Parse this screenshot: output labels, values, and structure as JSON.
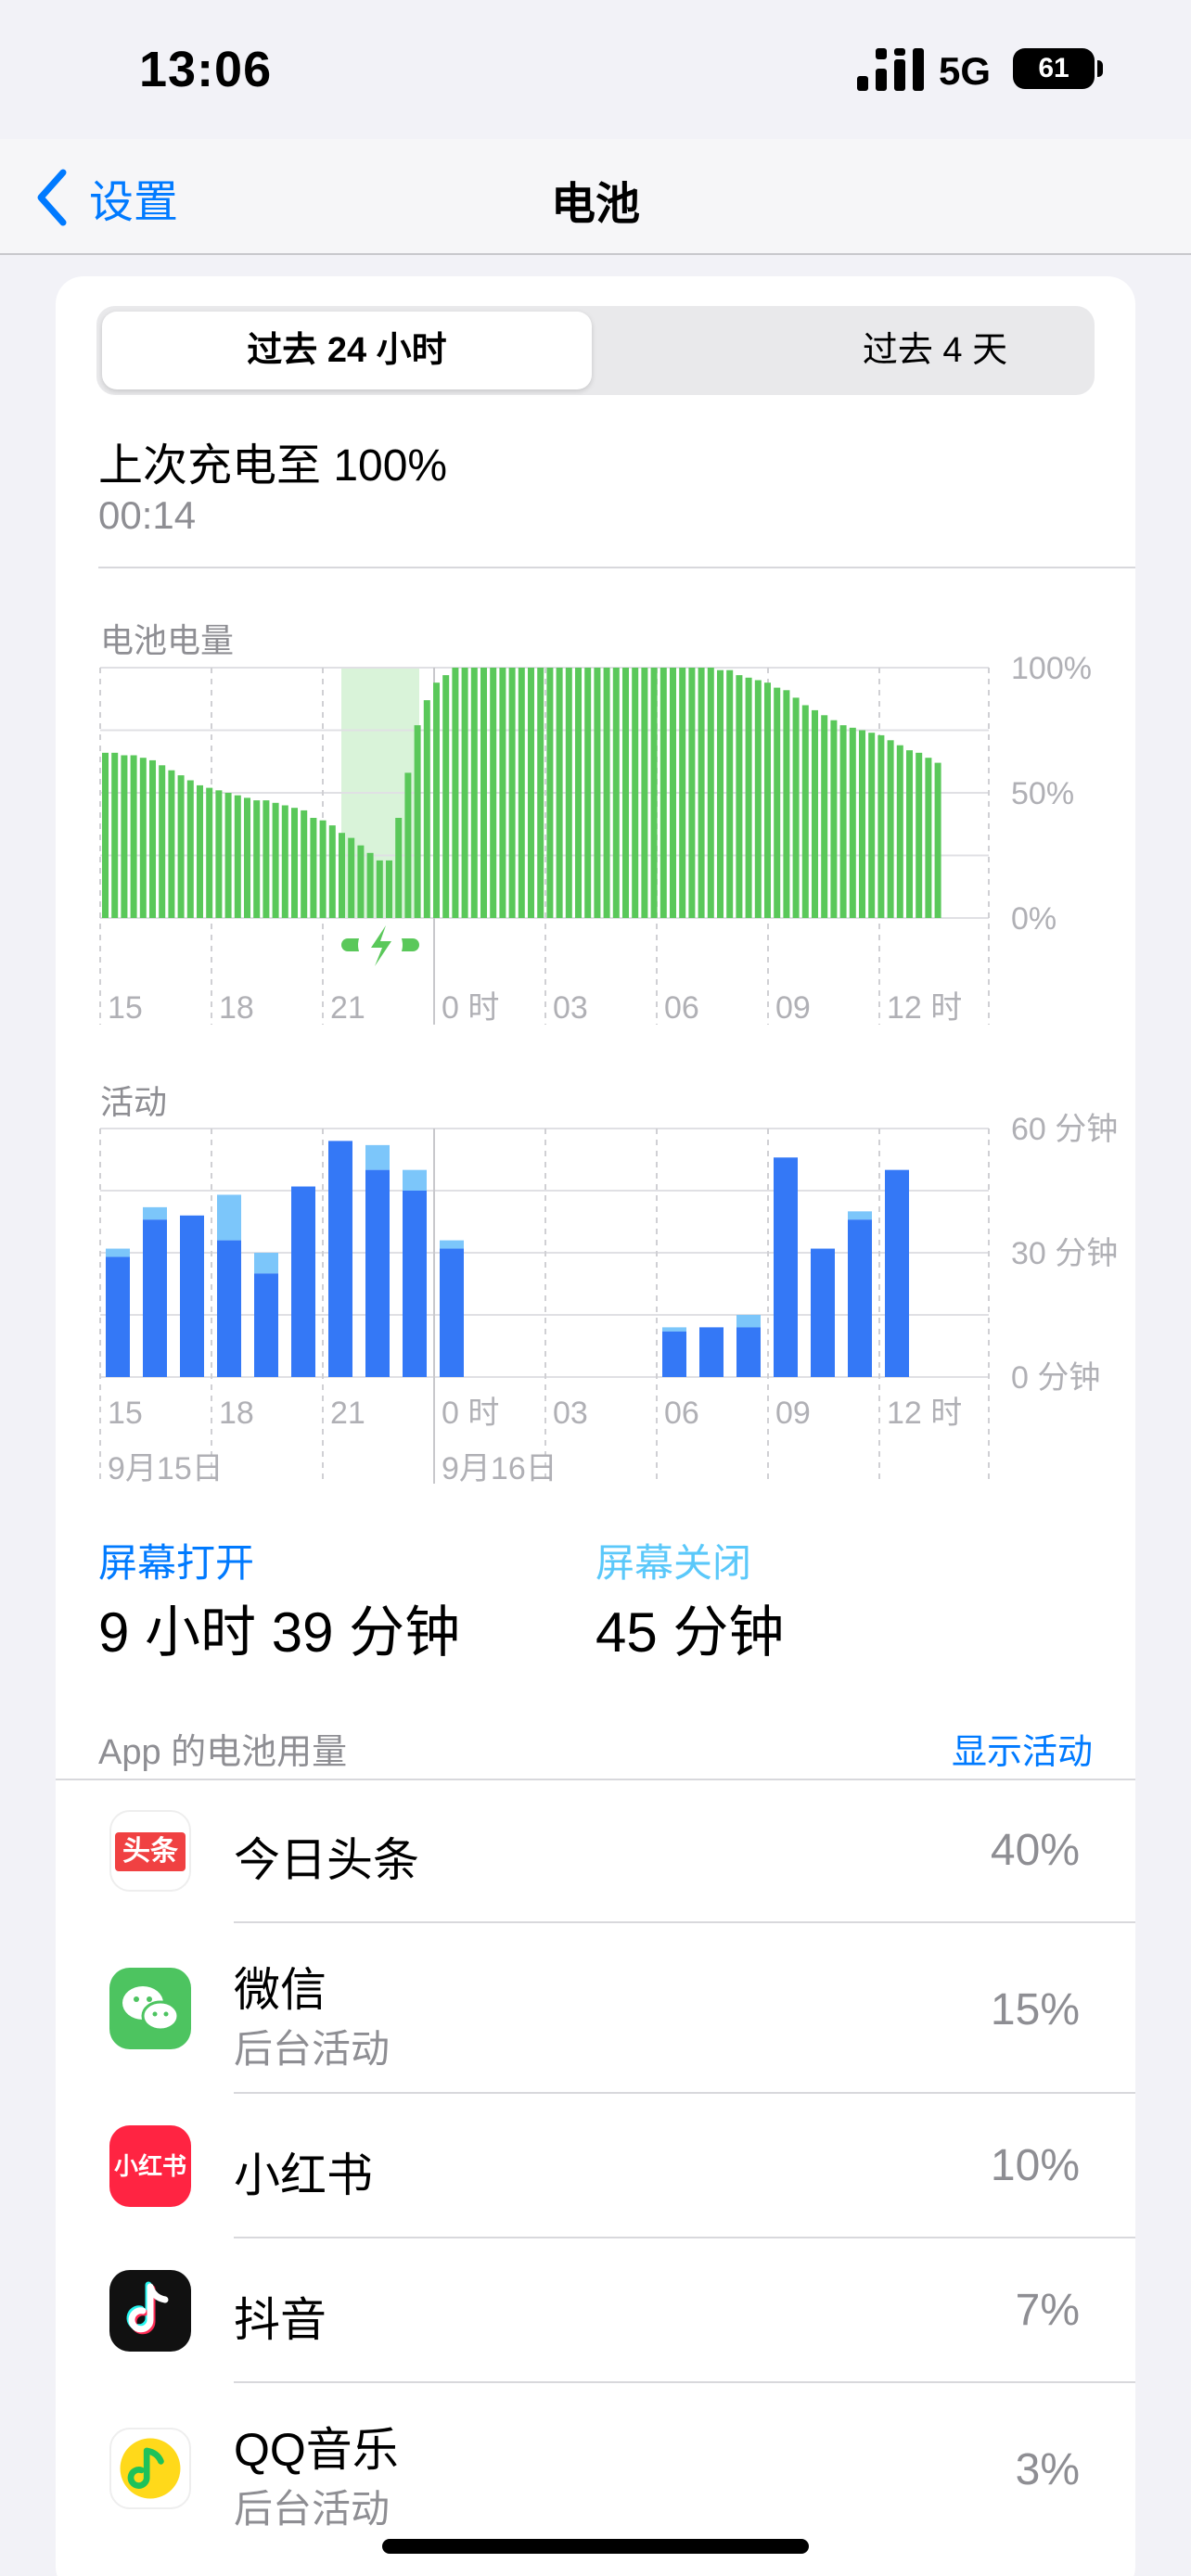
{
  "status_bar": {
    "time": "13:06",
    "network": "5G",
    "battery": "61"
  },
  "nav": {
    "back_label": "设置",
    "title": "电池"
  },
  "segments": {
    "active": "过去 24 小时",
    "inactive": "过去 4 天"
  },
  "last_charge": {
    "title": "上次充电至 100%",
    "time": "00:14"
  },
  "battery_chart": {
    "label": "电池电量",
    "y_ticks": [
      "100%",
      "50%",
      "0%"
    ],
    "x_ticks": [
      "15",
      "18",
      "21",
      "0 时",
      "03",
      "06",
      "09",
      "12 时"
    ]
  },
  "activity_chart": {
    "label": "活动",
    "y_ticks": [
      "60 分钟",
      "30 分钟",
      "0 分钟"
    ],
    "x_ticks": [
      "15",
      "18",
      "21",
      "0 时",
      "03",
      "06",
      "09",
      "12 时"
    ],
    "dates": [
      "9月15日",
      "9月16日"
    ]
  },
  "chart_data": [
    {
      "type": "bar",
      "title": "电池电量",
      "ylabel": "",
      "ylim": [
        0,
        100
      ],
      "x_ticks": [
        "15",
        "18",
        "21",
        "0 时",
        "03",
        "06",
        "09",
        "12 时"
      ],
      "charging_range_hours": [
        21.5,
        23.6
      ],
      "values": [
        66,
        66,
        65,
        65,
        64,
        63,
        61,
        59,
        57,
        55,
        53,
        52,
        51,
        50,
        49,
        48,
        47,
        47,
        46,
        45,
        44,
        43,
        40,
        39,
        37,
        34,
        32,
        29,
        26,
        23,
        23,
        40,
        58,
        77,
        87,
        94,
        97,
        100,
        100,
        100,
        100,
        100,
        100,
        100,
        100,
        100,
        100,
        100,
        100,
        100,
        100,
        100,
        100,
        100,
        100,
        100,
        100,
        100,
        100,
        100,
        100,
        100,
        100,
        100,
        100,
        99,
        99,
        97,
        96,
        95,
        94,
        92,
        91,
        88,
        85,
        83,
        81,
        79,
        77,
        76,
        75,
        74,
        73,
        71,
        69,
        67,
        66,
        64,
        62
      ]
    },
    {
      "type": "bar",
      "title": "活动",
      "ylabel": "",
      "ylim": [
        0,
        60
      ],
      "categories": [
        "15",
        "16",
        "17",
        "18",
        "19",
        "20",
        "21",
        "22",
        "23",
        "0",
        "1",
        "2",
        "3",
        "4",
        "5",
        "6",
        "7",
        "8",
        "9",
        "10",
        "11",
        "12"
      ],
      "series": [
        {
          "name": "屏幕打开",
          "values": [
            29,
            38,
            39,
            33,
            25,
            46,
            57,
            50,
            45,
            31,
            0,
            0,
            0,
            0,
            0,
            11,
            12,
            12,
            53,
            31,
            38,
            50
          ]
        },
        {
          "name": "屏幕关闭",
          "values": [
            2,
            3,
            0,
            11,
            5,
            0,
            0,
            6,
            5,
            2,
            0,
            0,
            0,
            0,
            0,
            1,
            0,
            3,
            0,
            0,
            2,
            0
          ]
        }
      ]
    }
  ],
  "stats": {
    "screen_on_label": "屏幕打开",
    "screen_on_value": "9 小时 39 分钟",
    "screen_off_label": "屏幕关闭",
    "screen_off_value": "45 分钟"
  },
  "usage": {
    "header": "App 的电池用量",
    "show_activity": "显示活动",
    "apps": [
      {
        "name": "今日头条",
        "sub": "",
        "percent": "40%",
        "icon_text": "头条",
        "icon_bg": "#f04142"
      },
      {
        "name": "微信",
        "sub": "后台活动",
        "percent": "15%",
        "icon_text": "",
        "icon_bg": "#4dc460"
      },
      {
        "name": "小红书",
        "sub": "",
        "percent": "10%",
        "icon_text": "小红书",
        "icon_bg": "#ff2442"
      },
      {
        "name": "抖音",
        "sub": "",
        "percent": "7%",
        "icon_text": "",
        "icon_bg": "#111111"
      },
      {
        "name": "QQ音乐",
        "sub": "后台活动",
        "percent": "3%",
        "icon_text": "",
        "icon_bg": "#ffffff"
      }
    ]
  },
  "colors": {
    "accent": "#007aff",
    "battery_green": "#5ac85a",
    "charge_tint": "#d9f3d9",
    "activity_blue": "#3478f6",
    "activity_light": "#7cc6fa"
  }
}
